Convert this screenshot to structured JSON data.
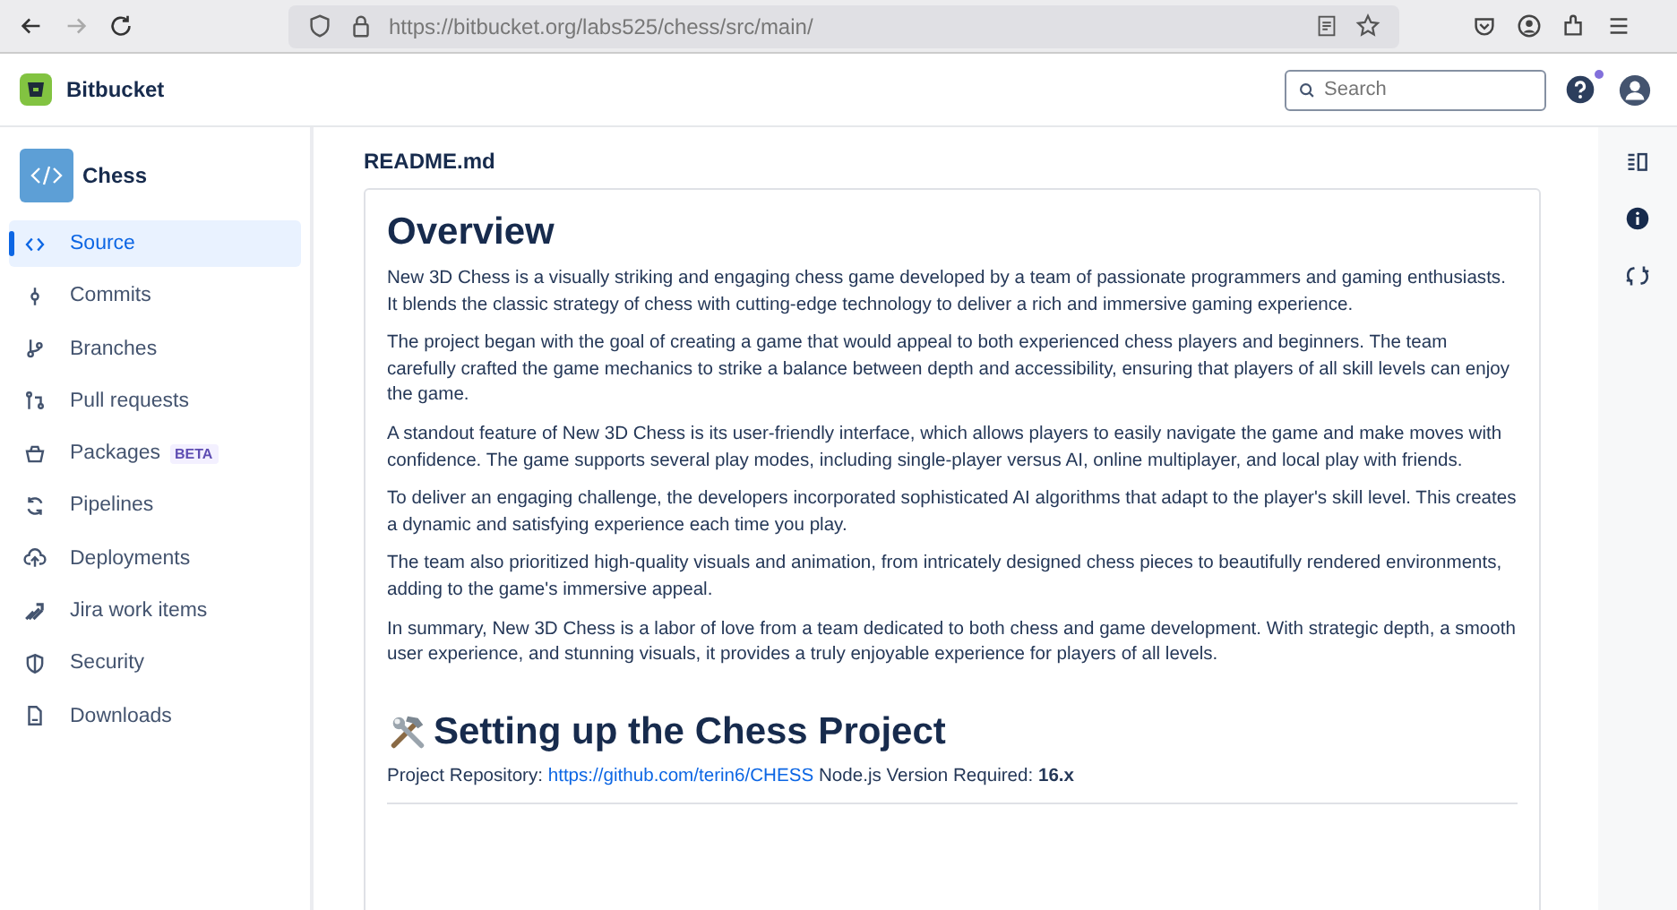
{
  "browser": {
    "url_host": "https://bitbucket.org",
    "url_path": "/labs525/chess/src/main/"
  },
  "header": {
    "product": "Bitbucket",
    "search": {
      "placeholder": "Search"
    },
    "help_notification": true
  },
  "sidebar": {
    "repo": "Chess",
    "items": [
      {
        "label": "Source",
        "selected": true
      },
      {
        "label": "Commits",
        "selected": false
      },
      {
        "label": "Branches",
        "selected": false
      },
      {
        "label": "Pull requests",
        "selected": false
      },
      {
        "label": "Packages",
        "badge": "BETA",
        "selected": false
      },
      {
        "label": "Pipelines",
        "selected": false
      },
      {
        "label": "Deployments",
        "selected": false
      },
      {
        "label": "Jira work items",
        "selected": false
      },
      {
        "label": "Security",
        "selected": false
      },
      {
        "label": "Downloads",
        "selected": false
      }
    ]
  },
  "readme": {
    "file": "README.md",
    "heading": "Overview",
    "paragraphs": [
      "New 3D Chess is a visually striking and engaging chess game developed by a team of passionate programmers and gaming enthusiasts. It blends the classic strategy of chess with cutting-edge technology to deliver a rich and immersive gaming experience.",
      "The project began with the goal of creating a game that would appeal to both experienced chess players and beginners. The team carefully crafted the game mechanics to strike a balance between depth and accessibility, ensuring that players of all skill levels can enjoy the game.",
      "A standout feature of New 3D Chess is its user-friendly interface, which allows players to easily navigate the game and make moves with confidence. The game supports several play modes, including single-player versus AI, online multiplayer, and local play with friends.",
      "To deliver an engaging challenge, the developers incorporated sophisticated AI algorithms that adapt to the player's skill level. This creates a dynamic and satisfying experience each time you play.",
      "The team also prioritized high-quality visuals and animation, from intricately designed chess pieces to beautifully rendered environments, adding to the game's immersive appeal.",
      "In summary, New 3D Chess is a labor of love from a team dedicated to both chess and game development. With strategic depth, a smooth user experience, and stunning visuals, it provides a truly enjoyable experience for players of all levels."
    ],
    "heading2": "Setting up the Chess Project",
    "repo_line": {
      "label": "Project Repository:",
      "link": "https://github.com/terin6/CHESS",
      "rest": "Node.js Version Required: **16.x**"
    }
  }
}
